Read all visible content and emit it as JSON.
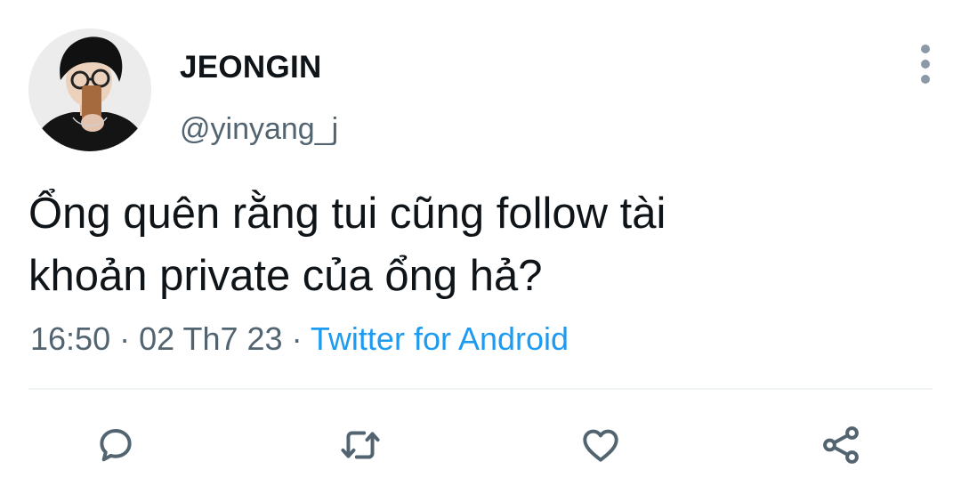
{
  "tweet": {
    "display_name": "JEONGIN",
    "handle": "@yinyang_j",
    "text": "Ổng quên rằng tui cũng follow tài\nkhoản private của ổng hả?",
    "time": "16:50",
    "separator": " · ",
    "date": "02 Th7 23",
    "source": "Twitter for Android"
  },
  "actions": {
    "icons": [
      "reply-icon",
      "retweet-icon",
      "like-icon",
      "share-icon"
    ]
  },
  "colors": {
    "text": "#0f1419",
    "secondary": "#536471",
    "link": "#1d9bf0",
    "divider": "#eff3f4",
    "icon": "#536471"
  }
}
